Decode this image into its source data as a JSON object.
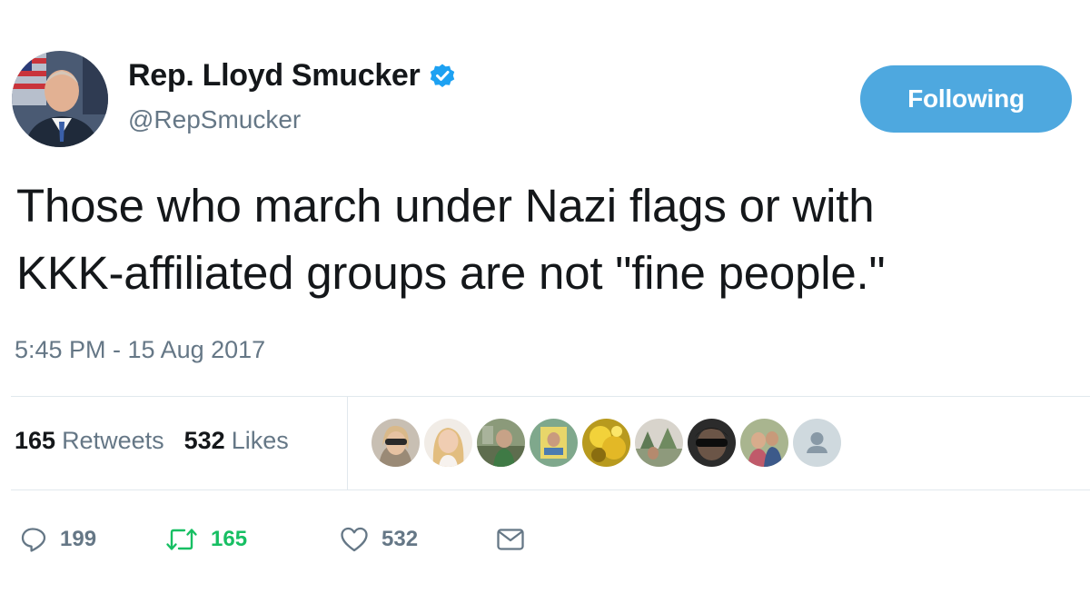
{
  "author": {
    "display_name": "Rep. Lloyd Smucker",
    "handle": "@RepSmucker",
    "verified_icon": "verified-badge-icon",
    "avatar_icon": "profile-photo"
  },
  "follow_button": {
    "label": "Following",
    "color": "#4ea8df"
  },
  "tweet": {
    "lines": [
      "Those who march under Nazi flags or with",
      "KKK-affiliated groups are not \"fine people.\""
    ],
    "timestamp": "5:45 PM - 15 Aug 2017"
  },
  "stats": {
    "retweets_count": "165",
    "retweets_label": "Retweets",
    "likes_count": "532",
    "likes_label": "Likes"
  },
  "likers": [
    "liker-avatar-sunglasses",
    "liker-avatar-blonde",
    "liker-avatar-green",
    "liker-avatar-photo",
    "liker-avatar-yellow",
    "liker-avatar-outdoor",
    "liker-avatar-dark",
    "liker-avatar-group",
    "liker-avatar-default"
  ],
  "actions": {
    "reply": {
      "icon": "reply-icon",
      "count": "199"
    },
    "retweet": {
      "icon": "retweet-icon",
      "count": "165",
      "color": "#17bf63"
    },
    "like": {
      "icon": "heart-icon",
      "count": "532"
    },
    "message": {
      "icon": "envelope-icon"
    }
  },
  "colors": {
    "text": "#14171a",
    "secondary": "#657786",
    "divider": "#e1e8ed"
  }
}
